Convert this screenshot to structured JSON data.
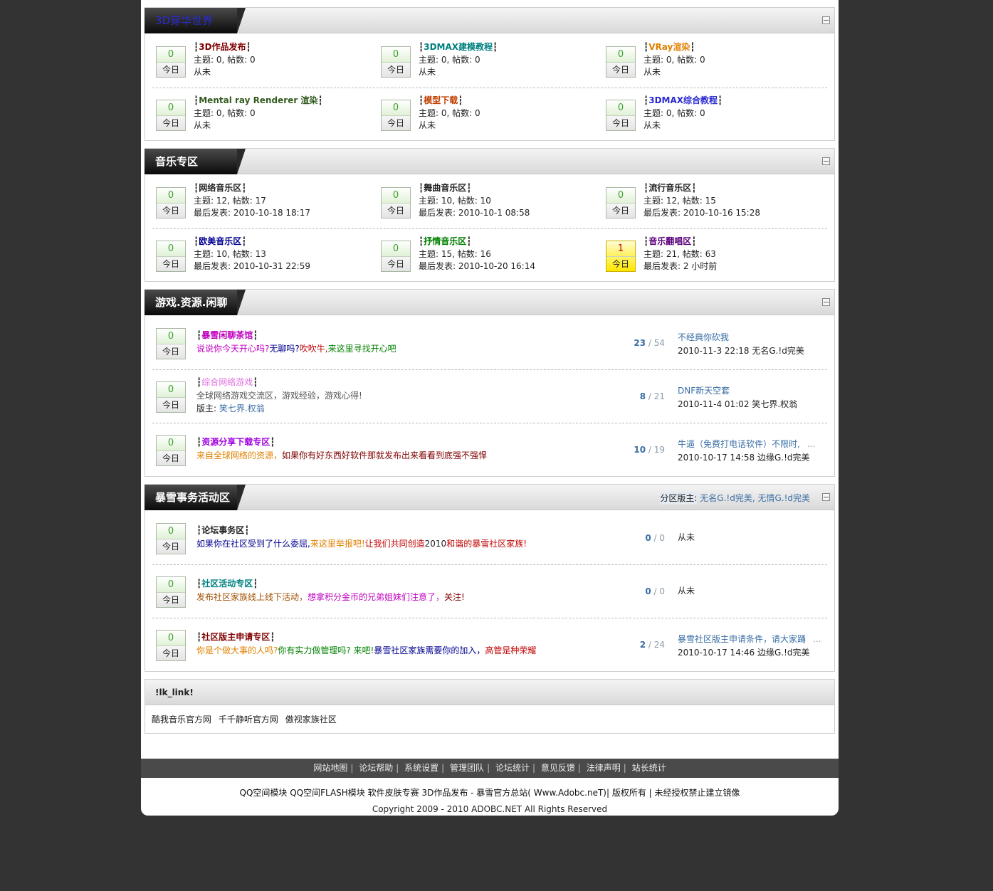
{
  "sections": {
    "s1": {
      "title": "3D穿华世界",
      "forums": [
        {
          "name": "3D作品发布",
          "stats": "主题: 0, 帖数: 0",
          "last": "从未",
          "today": "0"
        },
        {
          "name": "3DMAX建模教程",
          "stats": "主题: 0, 帖数: 0",
          "last": "从未",
          "today": "0"
        },
        {
          "name": "VRay渲染",
          "stats": "主题: 0, 帖数: 0",
          "last": "从未",
          "today": "0"
        },
        {
          "name": "Mental ray Renderer 渲染",
          "stats": "主题: 0, 帖数: 0",
          "last": "从未",
          "today": "0"
        },
        {
          "name": "模型下载",
          "stats": "主题: 0, 帖数: 0",
          "last": "从未",
          "today": "0"
        },
        {
          "name": "3DMAX综合教程",
          "stats": "主题: 0, 帖数: 0",
          "last": "从未",
          "today": "0"
        }
      ]
    },
    "s2": {
      "title": "音乐专区",
      "forums": [
        {
          "name": "网络音乐区",
          "stats": "主题: 12, 帖数: 17",
          "last": "最后发表: 2010-10-18 18:17",
          "today": "0"
        },
        {
          "name": "舞曲音乐区",
          "stats": "主题: 10, 帖数: 10",
          "last": "最后发表: 2010-10-1 08:58",
          "today": "0"
        },
        {
          "name": "流行音乐区",
          "stats": "主题: 12, 帖数: 15",
          "last": "最后发表: 2010-10-16 15:28",
          "today": "0"
        },
        {
          "name": "欧美音乐区",
          "stats": "主题: 10, 帖数: 13",
          "last": "最后发表: 2010-10-31 22:59",
          "today": "0"
        },
        {
          "name": "抒情音乐区",
          "stats": "主题: 15, 帖数: 16",
          "last": "最后发表: 2010-10-20 16:14",
          "today": "0"
        },
        {
          "name": "音乐翻唱区",
          "stats": "主题: 21, 帖数: 63",
          "last": "最后发表: 2 小时前",
          "today": "1"
        }
      ]
    },
    "s3": {
      "title": "游戏.资源.闲聊",
      "forums": [
        {
          "name": "暴雪闲聊茶馆",
          "desc": [
            "说说你今天开心吗?",
            "无聊吗?",
            "吹吹牛,",
            "来这里寻找开心吧"
          ],
          "topics": "23",
          "posts": "54",
          "last_title": "不经典你砍我",
          "last_info": "2010-11-3 22:18 无名G.!d完美",
          "today": "0"
        },
        {
          "name": "综合网络游戏",
          "desc": [
            "全球网络游戏交流区，游戏经验，游戏心得!"
          ],
          "moderator_label": "版主:",
          "moderator": "笑七界.权翁",
          "topics": "8",
          "posts": "21",
          "last_title": "DNF新天空套",
          "last_info": "2010-11-4 01:02 笑七界.权翁",
          "today": "0"
        },
        {
          "name": "资源分享下载专区",
          "desc": [
            "来自全球网络的资源，",
            "如果你有好东西好软件那就发布出来看看到底强不强悍"
          ],
          "topics": "10",
          "posts": "19",
          "last_title": "牛逼（免费打电话软件）不限时,",
          "last_ellipsis": "...",
          "last_info": "2010-10-17 14:58 边缘G.!d完美",
          "today": "0"
        }
      ]
    },
    "s4": {
      "title": "暴雪事务活动区",
      "moderators_label": "分区版主:",
      "moderators": "无名G.!d完美, 无情G.!d完美",
      "forums": [
        {
          "name": "论坛事务区",
          "desc": [
            "如果你在社区受到了什么委屈,",
            "来这里举报吧!",
            "让我们共同创造",
            "2010",
            "和谐的暴雪社区家族!"
          ],
          "topics": "0",
          "posts": "0",
          "last_title": "从未",
          "today": "0"
        },
        {
          "name": "社区活动专区",
          "desc": [
            "发布社区家族线上线下活动，",
            "想拿积分金币的兄弟姐妹们注意了，",
            "关注!"
          ],
          "topics": "0",
          "posts": "0",
          "last_title": "从未",
          "today": "0"
        },
        {
          "name": "社区版主申请专区",
          "desc": [
            "你是个做大事的人吗?",
            "你有实力做管理吗? 来吧!",
            "暴雪社区家族需要你的加入，",
            "高管是种荣耀"
          ],
          "topics": "2",
          "posts": "24",
          "last_title": "暴雪社区版主申请条件，请大家踊",
          "last_ellipsis": "...",
          "last_info": "2010-10-17 14:46 边缘G.!d完美",
          "today": "0"
        }
      ]
    }
  },
  "today_label": "今日",
  "bracket_left": "┇",
  "bracket_right": "┇",
  "links": {
    "title": "!lk_link!",
    "items": [
      "酷我音乐官方网",
      "千千静听官方网",
      "傲视家族社区"
    ]
  },
  "footer_nav": [
    "网站地图",
    "论坛帮助",
    "系统设置",
    "管理团队",
    "论坛统计",
    "意见反馈",
    "法律声明",
    "站长统计"
  ],
  "footer_links": "QQ空间模块  QQ空间FLASH模块  软件皮肤专赛  3D作品发布  - 暴雪官方总站( Www.Adobc.neT)| 版权所有  | 未经授权禁止建立镜像",
  "copyright": "Copyright 2009 - 2010 ADOBC.NET All Rights Reserved"
}
